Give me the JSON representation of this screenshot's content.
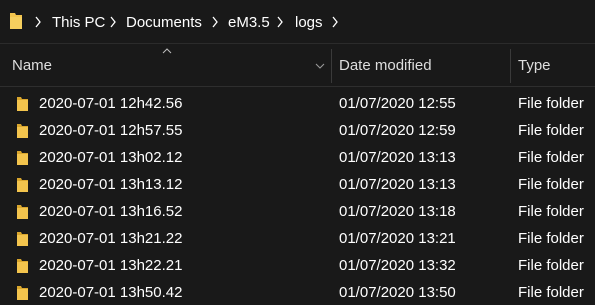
{
  "breadcrumb": {
    "items": [
      "This PC",
      "Documents",
      "eM3.5",
      "logs"
    ]
  },
  "columns": {
    "name": "Name",
    "date_modified": "Date modified",
    "type": "Type"
  },
  "files": [
    {
      "name": "2020-07-01 12h42.56",
      "date": "01/07/2020 12:55",
      "type": "File folder"
    },
    {
      "name": "2020-07-01 12h57.55",
      "date": "01/07/2020 12:59",
      "type": "File folder"
    },
    {
      "name": "2020-07-01 13h02.12",
      "date": "01/07/2020 13:13",
      "type": "File folder"
    },
    {
      "name": "2020-07-01 13h13.12",
      "date": "01/07/2020 13:13",
      "type": "File folder"
    },
    {
      "name": "2020-07-01 13h16.52",
      "date": "01/07/2020 13:18",
      "type": "File folder"
    },
    {
      "name": "2020-07-01 13h21.22",
      "date": "01/07/2020 13:21",
      "type": "File folder"
    },
    {
      "name": "2020-07-01 13h22.21",
      "date": "01/07/2020 13:32",
      "type": "File folder"
    },
    {
      "name": "2020-07-01 13h50.42",
      "date": "01/07/2020 13:50",
      "type": "File folder"
    }
  ],
  "colors": {
    "background": "#191919",
    "folder": "#f3c44d",
    "folder_dark": "#d9a62d"
  }
}
